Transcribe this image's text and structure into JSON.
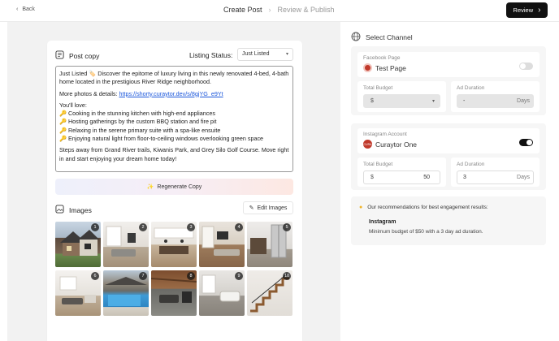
{
  "topbar": {
    "back_label": "Back",
    "steps": [
      "Create Post",
      "Review & Publish"
    ],
    "review_label": "Review"
  },
  "post_copy": {
    "title": "Post copy",
    "status_label": "Listing Status:",
    "status_value": "Just Listed",
    "paragraph1": "Just Listed 🏷️ Discover the epitome of luxury living in this newly renovated 4-bed, 4-bath home located in the prestigious River Ridge neighborhood.",
    "photos_prefix": "More photos & details: ",
    "photos_link": "https://shorty.curaytor.dev/s/8gjYG_e9Yt",
    "love_intro": "You'll love:",
    "bullets": [
      "🔑 Cooking in the stunning kitchen with high-end appliances",
      "🔑 Hosting gatherings by the custom BBQ station and fire pit",
      "🔑 Relaxing in the serene primary suite with a spa-like ensuite",
      "🔑 Enjoying natural light from floor-to-ceiling windows overlooking green space"
    ],
    "closing": "Steps away from Grand River trails, Kiwanis Park, and Grey Silo Golf Course. Move right in and start enjoying your dream home today!",
    "regenerate_label": "Regenerate Copy"
  },
  "images": {
    "title": "Images",
    "edit_label": "Edit Images",
    "items": [
      {
        "num": "1",
        "subject": "house exterior"
      },
      {
        "num": "2",
        "subject": "living room"
      },
      {
        "num": "3",
        "subject": "kitchen"
      },
      {
        "num": "4",
        "subject": "family room"
      },
      {
        "num": "5",
        "subject": "kitchen with fridge"
      },
      {
        "num": "6",
        "subject": "open living area"
      },
      {
        "num": "7",
        "subject": "backyard pool"
      },
      {
        "num": "8",
        "subject": "covered patio"
      },
      {
        "num": "9",
        "subject": "bathroom"
      },
      {
        "num": "10",
        "subject": "staircase"
      }
    ]
  },
  "channel": {
    "title": "Select Channel",
    "facebook": {
      "label": "Facebook Page",
      "name": "Test Page",
      "enabled": false,
      "budget_label": "Total Budget",
      "budget_prefix": "$",
      "duration_label": "Ad Duration",
      "duration_value": "-",
      "duration_suffix": "Days"
    },
    "instagram": {
      "label": "Instagram Account",
      "name": "Curaytor One",
      "enabled": true,
      "budget_label": "Total Budget",
      "budget_prefix": "$",
      "budget_value": "50",
      "duration_label": "Ad Duration",
      "duration_value": "3",
      "duration_suffix": "Days"
    }
  },
  "recommendation": {
    "title": "Our recommendations for best engagement results:",
    "channel": "Instagram",
    "text": "Minimum budget of $50 with a 3 day ad duration."
  },
  "colors": {
    "accent_dark": "#111111",
    "link": "#1a56db",
    "toggle_on": "#111111",
    "toggle_off": "#dddddd"
  }
}
